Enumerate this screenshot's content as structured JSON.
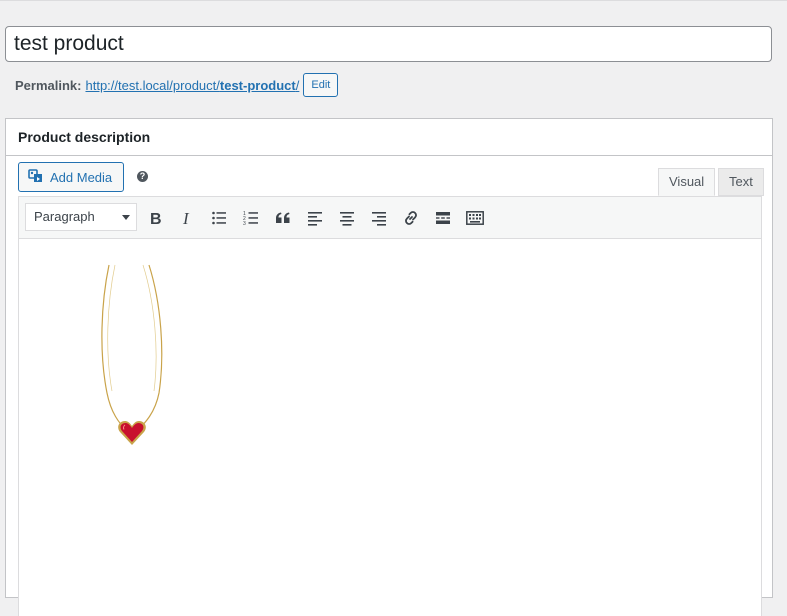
{
  "post": {
    "title": "test product"
  },
  "permalink": {
    "label": "Permalink:",
    "url_base": "http://test.local/product/",
    "slug": "test-product",
    "url_trailing": "/",
    "edit_label": "Edit"
  },
  "description_box": {
    "heading": "Product description",
    "add_media_label": "Add Media",
    "help_glyph": "?",
    "tabs": {
      "visual": "Visual",
      "text": "Text"
    },
    "format_select": {
      "selected": "Paragraph"
    },
    "toolbar_icons": [
      "bold-icon",
      "italic-icon",
      "bullet-list-icon",
      "numbered-list-icon",
      "blockquote-icon",
      "align-left-icon",
      "align-center-icon",
      "align-right-icon",
      "insert-link-icon",
      "read-more-icon",
      "toolbar-toggle-icon"
    ],
    "content": {
      "image": "heart-necklace-image"
    }
  },
  "colors": {
    "accent": "#2271b1",
    "background": "#f0f0f1",
    "heart": "#c8102e",
    "chain": "#c9a34a"
  }
}
